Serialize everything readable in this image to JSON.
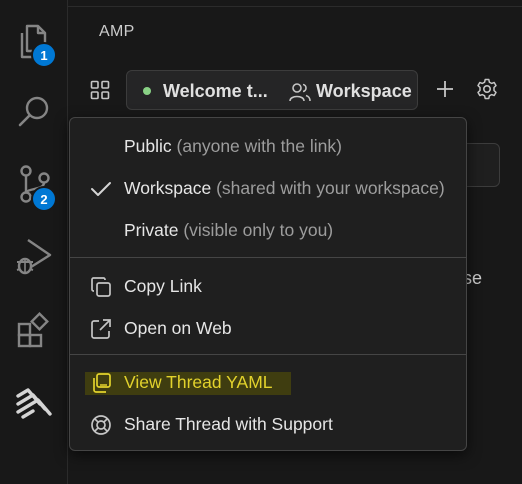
{
  "activity_bar": {
    "explorer_badge": "1",
    "source_control_badge": "2"
  },
  "panel": {
    "title": "AMP"
  },
  "toolbar": {
    "thread_title": "Welcome t...",
    "thread_scope": "Workspace",
    "status_color": "#89d185"
  },
  "background": {
    "partial_text": "se"
  },
  "menu": {
    "visibility_options": [
      {
        "label": "Public",
        "hint": "(anyone with the link)",
        "checked": false
      },
      {
        "label": "Workspace",
        "hint": "(shared with your workspace)",
        "checked": true
      },
      {
        "label": "Private",
        "hint": "(visible only to you)",
        "checked": false
      }
    ],
    "copy_link": "Copy Link",
    "open_on_web": "Open on Web",
    "view_thread_yaml": "View Thread YAML",
    "share_with_support": "Share Thread with Support"
  },
  "colors": {
    "accent_badge": "#0078d4",
    "yaml_highlight": "#e2d22c"
  }
}
